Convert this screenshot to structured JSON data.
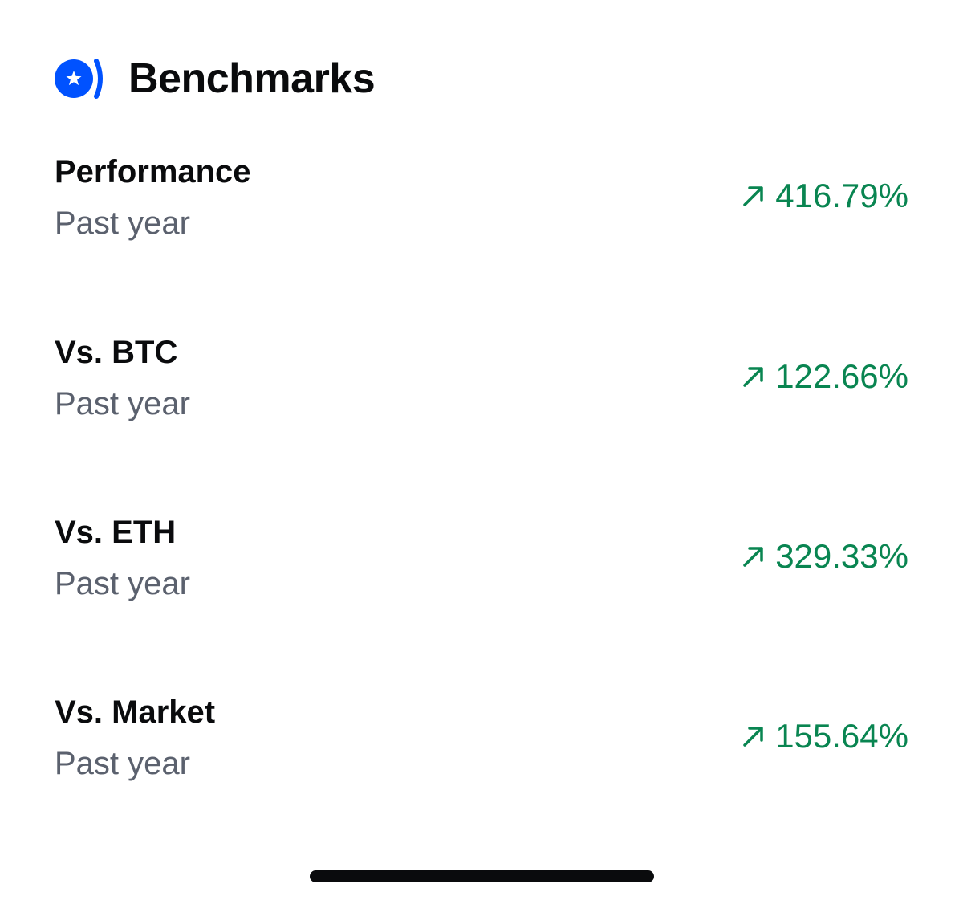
{
  "header": {
    "title": "Benchmarks",
    "icon": "star-moon-icon",
    "accent_color": "#0052ff"
  },
  "benchmarks": [
    {
      "label": "Performance",
      "period": "Past year",
      "value": "416.79%",
      "direction": "up"
    },
    {
      "label": "Vs. BTC",
      "period": "Past year",
      "value": "122.66%",
      "direction": "up"
    },
    {
      "label": "Vs. ETH",
      "period": "Past year",
      "value": "329.33%",
      "direction": "up"
    },
    {
      "label": "Vs. Market",
      "period": "Past year",
      "value": "155.64%",
      "direction": "up"
    }
  ],
  "colors": {
    "positive": "#098551",
    "primary_text": "#0a0b0d",
    "secondary_text": "#5b616e"
  }
}
